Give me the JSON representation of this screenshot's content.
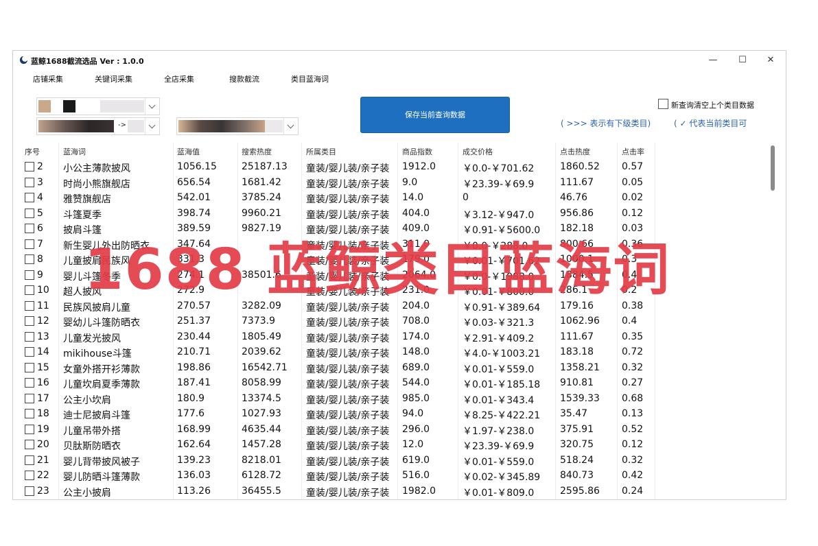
{
  "window": {
    "title": "蓝鲸1688截流选品 Ver : 1.0.0",
    "minimize": "—",
    "maximize": "☐",
    "close": "✕"
  },
  "menu": [
    "店铺采集",
    "关键词采集",
    "全店采集",
    "搜款截流",
    "类目蓝海词"
  ],
  "combo2_value": "->",
  "save_button": "保存当前查询数据",
  "clear_checkbox": {
    "label": "新查询清空上个类目数据",
    "checked": false
  },
  "legend_sub": "( >>> 表示有下级类目)",
  "legend_current": "( ✓ 代表当前类目可",
  "columns": [
    "序号",
    "蓝海词",
    "蓝海值",
    "搜索热度",
    "所属类目",
    "商品指数",
    "成交价格",
    "点击热度",
    "点击率"
  ],
  "rows": [
    [
      "2",
      "小公主薄款披风",
      "1056.15",
      "25187.13",
      "童装/婴儿装/亲子装",
      "1912.0",
      "￥0.0-￥701.62",
      "1860.52",
      "0.57"
    ],
    [
      "3",
      "时尚小熊旗舰店",
      "656.54",
      "1681.42",
      "童装/婴儿装/亲子装",
      "9.0",
      "￥23.39-￥69.9",
      "111.67",
      "0.05"
    ],
    [
      "4",
      "雅赞旗舰店",
      "542.01",
      "3785.24",
      "童装/婴儿装/亲子装",
      "14.0",
      "0",
      "46.76",
      "0.02"
    ],
    [
      "5",
      "斗篷夏季",
      "398.74",
      "9960.21",
      "童装/婴儿装/亲子装",
      "404.0",
      "￥3.12-￥947.0",
      "956.86",
      "0.12"
    ],
    [
      "6",
      "披肩斗篷",
      "389.59",
      "9827.19",
      "童装/婴儿装/亲子装",
      "409.0",
      "￥0.91-￥5600.0",
      "182.18",
      "0.03"
    ],
    [
      "7",
      "新生婴儿外出防晒衣",
      "347.64",
      "",
      "童装/婴儿装/亲子装",
      "311.0",
      "￥0.0-￥288.0",
      "800.66",
      "0.36"
    ],
    [
      "8",
      "儿童披肩民族风",
      "331.3",
      "",
      "童装/婴儿装/亲子装",
      "179.0",
      "￥0.01-￥701.62",
      "1000.1",
      "0.3"
    ],
    [
      "9",
      "婴儿斗篷冬季",
      "274.1",
      "38501.6",
      "童装/婴儿装/亲子装",
      "2064.0",
      "￥0.0-￥1988.0",
      "1884.5",
      "0.4"
    ],
    [
      "10",
      "超人披风",
      "272.9",
      "",
      "童装/婴儿装/亲子装",
      "231.0",
      "￥0.01-￥800.0",
      "286.1",
      "0.2"
    ],
    [
      "11",
      "民族风披肩儿童",
      "270.57",
      "3282.09",
      "童装/婴儿装/亲子装",
      "204.0",
      "￥0.91-￥389.64",
      "179.16",
      "0.38"
    ],
    [
      "12",
      "婴幼儿斗篷防晒衣",
      "251.37",
      "7373.9",
      "童装/婴儿装/亲子装",
      "708.0",
      "￥0.03-￥321.3",
      "1062.96",
      "0.4"
    ],
    [
      "13",
      "儿童发光披风",
      "230.44",
      "1805.49",
      "童装/婴儿装/亲子装",
      "174.0",
      "￥2.91-￥409.2",
      "111.67",
      "0.35"
    ],
    [
      "14",
      "mikihouse斗篷",
      "210.71",
      "2039.62",
      "童装/婴儿装/亲子装",
      "148.0",
      "￥4.0-￥1003.21",
      "183.18",
      "0.72"
    ],
    [
      "15",
      "女童外搭开衫薄款",
      "198.86",
      "16542.71",
      "童装/婴儿装/亲子装",
      "689.0",
      "￥0.01-￥559.0",
      "1358.21",
      "0.32"
    ],
    [
      "16",
      "儿童坎肩夏季薄款",
      "187.41",
      "8058.99",
      "童装/婴儿装/亲子装",
      "544.0",
      "￥0.01-￥185.18",
      "910.81",
      "0.27"
    ],
    [
      "17",
      "公主小坎肩",
      "180.9",
      "13374.5",
      "童装/婴儿装/亲子装",
      "985.0",
      "￥0.01-￥343.4",
      "1539.33",
      "0.68"
    ],
    [
      "18",
      "迪士尼披肩斗篷",
      "177.6",
      "1027.93",
      "童装/婴儿装/亲子装",
      "94.0",
      "￥8.25-￥422.21",
      "35.47",
      "0.13"
    ],
    [
      "19",
      "儿童吊带外搭",
      "168.99",
      "4635.44",
      "童装/婴儿装/亲子装",
      "296.0",
      "￥1.97-￥238.0",
      "375.91",
      "0.52"
    ],
    [
      "20",
      "贝肽斯防晒衣",
      "162.64",
      "1457.28",
      "童装/婴儿装/亲子装",
      "12.0",
      "￥23.39-￥69.9",
      "320.75",
      "0.12"
    ],
    [
      "21",
      "婴儿背带披风被子",
      "139.23",
      "8218.01",
      "童装/婴儿装/亲子装",
      "619.0",
      "￥0.01-￥559.0",
      "518.24",
      "0.32"
    ],
    [
      "22",
      "婴儿防晒斗篷薄款",
      "136.03",
      "6128.72",
      "童装/婴儿装/亲子装",
      "516.0",
      "￥0.02-￥345.89",
      "840.73",
      "0.42"
    ],
    [
      "23",
      "公主小披肩",
      "113.26",
      "36455.5",
      "童装/婴儿装/亲子装",
      "1982.0",
      "￥0.01-￥809.0",
      "2595.86",
      "0.24"
    ]
  ],
  "watermark": "1688 蓝鲸类目蓝海词",
  "colors": {
    "button_bg": "#1f6fc0",
    "legend": "#2a63b0",
    "watermark": "#e33c46"
  }
}
